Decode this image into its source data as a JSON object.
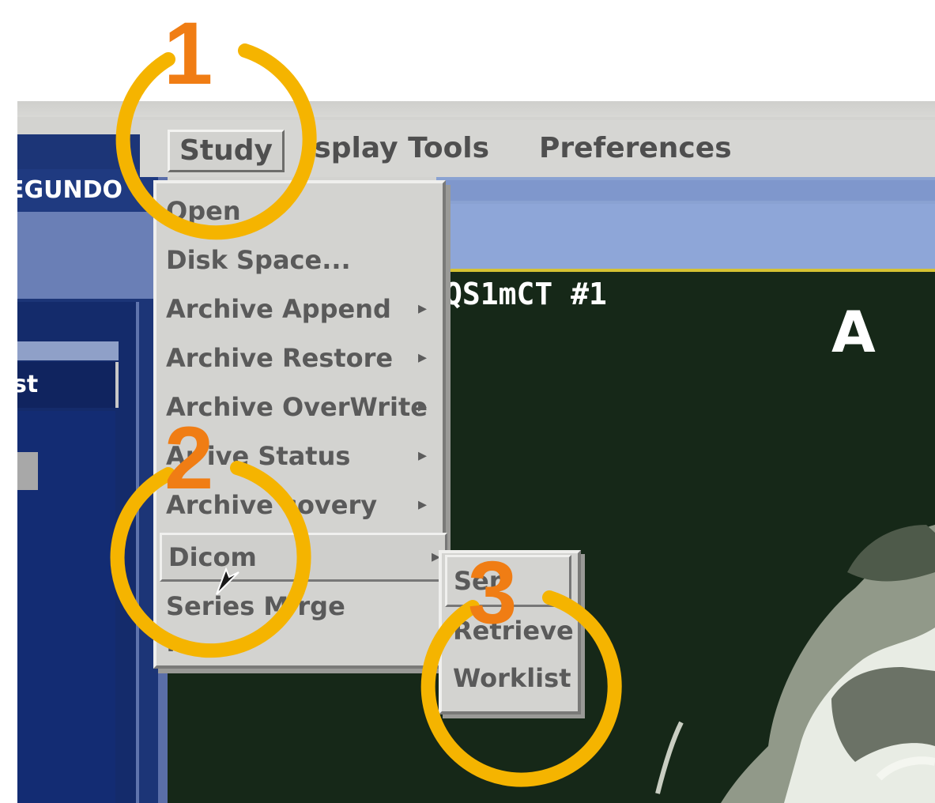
{
  "menubar": {
    "study": "Study",
    "display_tools": "isplay Tools",
    "preferences": "Preferences"
  },
  "left_window": {
    "title": "EGUNDO",
    "list_header": "st"
  },
  "study_menu": {
    "items": [
      {
        "label": "Open",
        "submenu": false
      },
      {
        "label": "Disk Space...",
        "submenu": false
      },
      {
        "label": "Archive Append",
        "submenu": true
      },
      {
        "label": "Archive Restore",
        "submenu": true
      },
      {
        "label": "Archive OverWrite",
        "submenu": true
      },
      {
        "label": "Ar   ive Status",
        "submenu": true
      },
      {
        "label": "Archive  covery",
        "submenu": true
      },
      {
        "label": "Dicom",
        "submenu": true,
        "selected": true
      },
      {
        "label": "Series M   rge",
        "submenu": false
      },
      {
        "label": "...",
        "submenu": false
      }
    ],
    "arrow_glyph": "▸"
  },
  "dicom_submenu": {
    "items": [
      {
        "label": "Sen",
        "selected": true
      },
      {
        "label": "Retrieve"
      },
      {
        "label": "Worklist"
      }
    ]
  },
  "viewer": {
    "series_label": "QS1mCT #1",
    "orientation": "A"
  },
  "annotations": {
    "steps": [
      "1",
      "2",
      "3"
    ],
    "ring_color": "#f5b400",
    "number_color": "#f07d14"
  },
  "colors": {
    "panel_blue": "#1c3577",
    "menu_gray": "#d3d3d0",
    "image_bg": "#162818"
  }
}
